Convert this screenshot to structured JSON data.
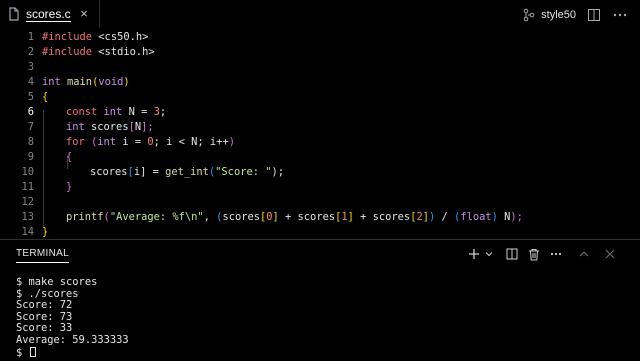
{
  "tab": {
    "filename": "scores.c",
    "close_glyph": "×",
    "icon": "c-file-icon"
  },
  "titlebar": {
    "style50_label": "style50",
    "icons": [
      "style50-icon",
      "split-editor-icon",
      "more-icon"
    ]
  },
  "editor": {
    "active_line": 6,
    "lines": [
      {
        "n": "1"
      },
      {
        "n": "2"
      },
      {
        "n": "3"
      },
      {
        "n": "4"
      },
      {
        "n": "5"
      },
      {
        "n": "6"
      },
      {
        "n": "7"
      },
      {
        "n": "8"
      },
      {
        "n": "9"
      },
      {
        "n": "10"
      },
      {
        "n": "11"
      },
      {
        "n": "12"
      },
      {
        "n": "13"
      },
      {
        "n": "14"
      }
    ],
    "tokens": {
      "l1": [
        "#include",
        " <cs50.h>"
      ],
      "l2": [
        "#include",
        " <stdio.h>"
      ],
      "l4": [
        "int",
        " main",
        "(",
        "void",
        ")"
      ],
      "l5": [
        "{"
      ],
      "l6": [
        "const",
        " int",
        " N = ",
        "3",
        ";"
      ],
      "l7": [
        "int",
        " scores",
        "[",
        "N",
        "];"
      ],
      "l8": [
        "for",
        " (",
        "int",
        " i = ",
        "0",
        "; i < N; i++",
        ")"
      ],
      "l9": [
        "{"
      ],
      "l10": [
        "scores",
        "[",
        "i",
        "] = ",
        "get_int",
        "(",
        "\"Score: \"",
        ");"
      ],
      "l11": [
        "}"
      ],
      "l13": [
        "printf",
        "(",
        "\"Average: %f\\n\"",
        ", ",
        "(",
        "scores",
        "[",
        "0",
        "]",
        " + scores",
        "[",
        "1",
        "]",
        " + scores",
        "[",
        "2",
        "]",
        ")",
        " / ",
        "(",
        "float",
        ")",
        " N",
        ");"
      ],
      "l14": [
        "}"
      ]
    }
  },
  "panel": {
    "tab_label": "TERMINAL",
    "actions": [
      "add-icon",
      "chevron-down-icon",
      "split-terminal-icon",
      "trash-icon",
      "more-icon",
      "chevron-up-icon",
      "close-icon"
    ],
    "terminal_lines": [
      "$ make scores",
      "$ ./scores",
      "Score: 72",
      "Score: 73",
      "Score: 33",
      "Average: 59.333333"
    ],
    "prompt": "$ "
  },
  "colors": {
    "background": "#000000",
    "keyword": "#f07178",
    "type": "#c792ea",
    "string": "#c3e88d",
    "number": "#f78c6c",
    "function": "#dcdcaa",
    "bracket1": "#ffd700",
    "bracket2": "#da70d6",
    "bracket3": "#179fff"
  }
}
